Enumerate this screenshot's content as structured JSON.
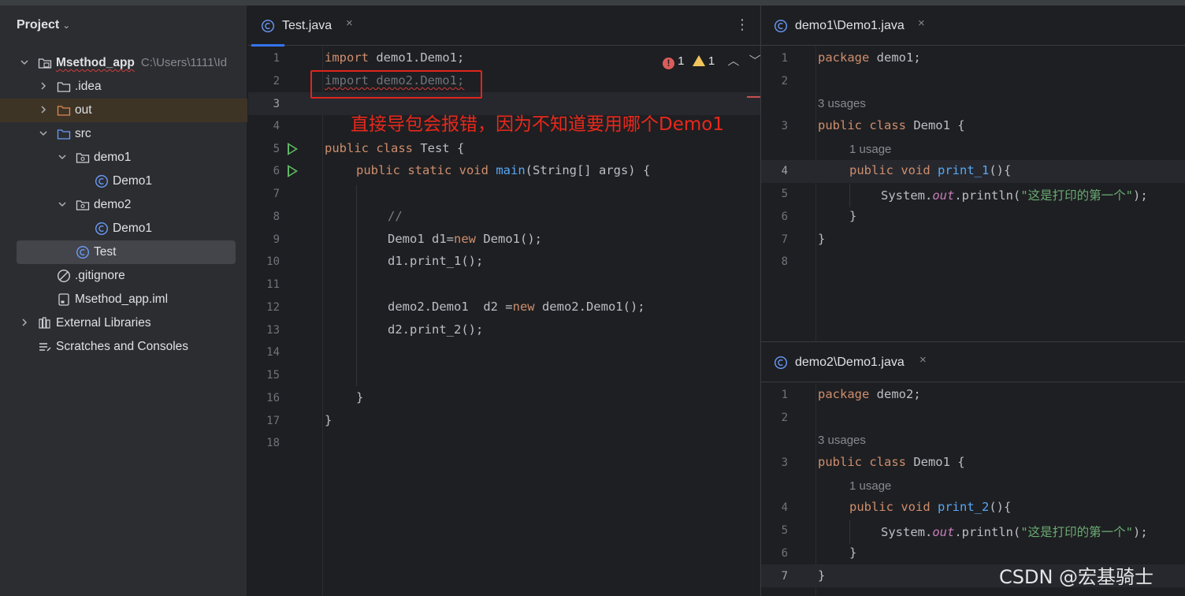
{
  "project_panel": {
    "title": "Project",
    "tree": [
      {
        "label": "Msethod_app",
        "path": "C:\\Users\\1111\\Id"
      },
      {
        "label": ".idea"
      },
      {
        "label": "out"
      },
      {
        "label": "src"
      },
      {
        "label": "demo1"
      },
      {
        "label": "Demo1"
      },
      {
        "label": "demo2"
      },
      {
        "label": "Demo1"
      },
      {
        "label": "Test"
      },
      {
        "label": ".gitignore"
      },
      {
        "label": "Msethod_app.iml"
      },
      {
        "label": "External Libraries"
      },
      {
        "label": "Scratches and Consoles"
      }
    ]
  },
  "editor_main": {
    "tab_label": "Test.java",
    "close_glyph": "×",
    "menu_glyph": "⋮",
    "inspection": {
      "errors": "1",
      "warnings": "1"
    },
    "line_numbers": [
      "1",
      "2",
      "3",
      "4",
      "5",
      "6",
      "7",
      "8",
      "9",
      "10",
      "11",
      "12",
      "13",
      "14",
      "15",
      "16",
      "17",
      "18"
    ],
    "code": {
      "l1_kw": "import",
      "l1_rest": " demo1.Demo1;",
      "l2": "import demo2.Demo1;",
      "l5_kw": "public class",
      "l5_rest": " Test {",
      "l6_kw": "public static void",
      "l6_fn": "main",
      "l6_rest": "(String[] args) {",
      "l8": "//",
      "l9_a": "Demo1 d1=",
      "l9_kw": "new",
      "l9_b": " Demo1();",
      "l10": "d1.print_1();",
      "l12_a": "demo2.Demo1  d2 =",
      "l12_kw": "new",
      "l12_b": " demo2.Demo1();",
      "l13": "d2.print_2();",
      "l16": "}",
      "l17": "}"
    },
    "annotation": "直接导包会报错，因为不知道要用哪个Demo1"
  },
  "editor_demo1": {
    "tab_label": "demo1\\Demo1.java",
    "close_glyph": "×",
    "line_numbers": [
      "1",
      "2",
      "3",
      "4",
      "5",
      "6",
      "7",
      "8"
    ],
    "code": {
      "pkg_kw": "package",
      "pkg_rest": " demo1;",
      "usages_class": "3 usages",
      "class_kw": "public class",
      "class_rest": " Demo1 {",
      "usages_method": "1 usage",
      "m_kw": "public void",
      "m_fn": "print_1",
      "m_rest": "(){",
      "println_a": "System.",
      "println_out": "out",
      "println_b": ".println(",
      "println_str": "\"这是打印的第一个\"",
      "println_c": ");",
      "close_method": "}",
      "close_class": "}"
    }
  },
  "editor_demo2": {
    "tab_label": "demo2\\Demo1.java",
    "close_glyph": "×",
    "line_numbers": [
      "1",
      "2",
      "3",
      "4",
      "5",
      "6",
      "7"
    ],
    "code": {
      "pkg_kw": "package",
      "pkg_rest": " demo2;",
      "usages_class": "3 usages",
      "class_kw": "public class",
      "class_rest": " Demo1 {",
      "usages_method": "1 usage",
      "m_kw": "public void",
      "m_fn": "print_2",
      "m_rest": "(){",
      "println_a": "System.",
      "println_out": "out",
      "println_b": ".println(",
      "println_str": "\"这是打印的第一个\"",
      "println_c": ");",
      "close_method": "}",
      "close_class": "}"
    }
  },
  "watermark": "CSDN @宏基骑士",
  "colors": {
    "keyword": "#cf8e6d",
    "function": "#56a8f5",
    "string": "#6aab73",
    "static_field": "#c77dbb",
    "annotation_red": "#e8281c",
    "accent": "#3574f0"
  }
}
